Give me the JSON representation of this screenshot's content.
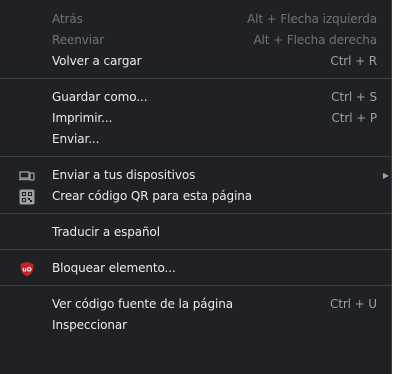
{
  "menu": {
    "items": {
      "back": {
        "label": "Atrás",
        "shortcut": "Alt + Flecha izquierda"
      },
      "forward": {
        "label": "Reenviar",
        "shortcut": "Alt + Flecha derecha"
      },
      "reload": {
        "label": "Volver a cargar",
        "shortcut": "Ctrl + R"
      },
      "save_as": {
        "label": "Guardar como...",
        "shortcut": "Ctrl + S"
      },
      "print": {
        "label": "Imprimir...",
        "shortcut": "Ctrl + P"
      },
      "send": {
        "label": "Enviar..."
      },
      "send_devices": {
        "label": "Enviar a tus dispositivos",
        "icon": "devices-icon"
      },
      "qr_code": {
        "label": "Crear código QR para esta página",
        "icon": "qr-code-icon"
      },
      "translate": {
        "label": "Traducir a español"
      },
      "block_element": {
        "label": "Bloquear elemento...",
        "icon": "ublock-origin-icon"
      },
      "view_source": {
        "label": "Ver código fuente de la página",
        "shortcut": "Ctrl + U"
      },
      "inspect": {
        "label": "Inspeccionar"
      }
    }
  },
  "colors": {
    "background": "#202124",
    "text": "#e8eaed",
    "disabled_text": "#6f7378",
    "shortcut_text": "#9aa0a6",
    "separator": "#3c4043",
    "ublock_red": "#c0242b"
  }
}
